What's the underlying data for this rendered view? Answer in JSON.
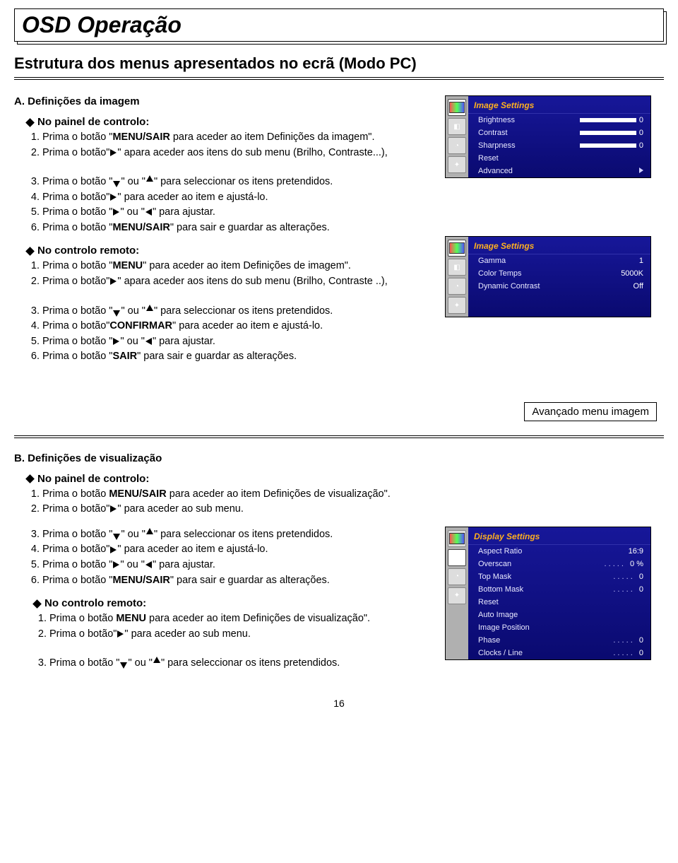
{
  "page": {
    "title": "OSD Operação",
    "subtitle": "Estrutura dos menus apresentados no ecrã (Modo PC)",
    "pageNumber": "16"
  },
  "sectionA": {
    "heading": "A. Definições da imagem",
    "panelHeading": "No painel de controlo:",
    "panelSteps": {
      "s1a": "Prima o botão \"",
      "s1b": "MENU/SAIR",
      "s1c": " para aceder ao item Definições da imagem\".",
      "s2a": "Prima o botão\"",
      "s2b": "\" apara aceder aos itens do sub menu (Brilho, Contraste...),",
      "s3a": "Prima o botão \"",
      "s3b": "\" ou \"",
      "s3c": "\" para seleccionar os itens pretendidos.",
      "s4a": "Prima o botão\"",
      "s4b": "\" para aceder ao item e ajustá-lo.",
      "s5a": "Prima o botão \"",
      "s5b": "\" ou \"",
      "s5c": "\" para ajustar.",
      "s6a": "Prima o botão \"",
      "s6b": "MENU/SAIR",
      "s6c": "\" para sair e guardar as alterações."
    },
    "remoteHeading": "No controlo remoto:",
    "remoteSteps": {
      "s1a": "Prima o botão \"",
      "s1b": "MENU",
      "s1c": "\" para aceder ao item Definições de imagem\".",
      "s2a": "Prima o botão\"",
      "s2b": "\" apara aceder aos itens do sub menu (Brilho, Contraste ..),",
      "s3a": "Prima o botão \"",
      "s3b": "\" ou \"",
      "s3c": "\" para seleccionar os itens pretendidos.",
      "s4a": "Prima o botão\"",
      "s4b": "CONFIRMAR",
      "s4c": "\" para aceder ao item e ajustá-lo.",
      "s5a": "Prima o botão \"",
      "s5b": "\" ou \"",
      "s5c": "\" para ajustar.",
      "s6a": "Prima o botão \"",
      "s6b": "SAIR",
      "s6c": "\" para sair e guardar as alterações."
    }
  },
  "osd1": {
    "header": "Image Settings",
    "rows": [
      {
        "label": "Brightness",
        "val": "0",
        "slider": true
      },
      {
        "label": "Contrast",
        "val": "0",
        "slider": true
      },
      {
        "label": "Sharpness",
        "val": "0",
        "slider": true
      },
      {
        "label": "Reset",
        "val": ""
      },
      {
        "label": "Advanced",
        "val": "▶"
      }
    ]
  },
  "osd2": {
    "header": "Image Settings",
    "rows": [
      {
        "label": "Gamma",
        "val": "1"
      },
      {
        "label": "Color Temps",
        "val": "5000K"
      },
      {
        "label": "Dynamic Contrast",
        "val": "Off"
      }
    ]
  },
  "callout": "Avançado menu imagem",
  "sectionB": {
    "heading": "B. Definições de visualização",
    "panelHeading": "No painel de controlo:",
    "panelSteps": {
      "s1a": "Prima o botão ",
      "s1b": "MENU/SAIR",
      "s1c": " para aceder ao item Definições de visualização\".",
      "s2a": "Prima o botão\"",
      "s2b": "\" para aceder ao sub menu.",
      "s3a": "Prima o botão \"",
      "s3b": "\" ou \"",
      "s3c": "\" para seleccionar os itens pretendidos.",
      "s4a": "Prima o botão\"",
      "s4b": "\" para aceder ao item e ajustá-lo.",
      "s5a": "Prima o botão \"",
      "s5b": "\" ou \"",
      "s5c": "\" para ajustar.",
      "s6a": "Prima o botão \"",
      "s6b": "MENU/SAIR",
      "s6c": "\" para sair e guardar as alterações."
    },
    "remoteHeading": "No controlo remoto:",
    "remoteSteps": {
      "s1a": "Prima o botão ",
      "s1b": "MENU",
      "s1c": " para aceder ao item Definições de visualização\".",
      "s2a": "Prima o botão\"",
      "s2b": "\" para aceder ao sub menu.",
      "s3a": "Prima o botão \"",
      "s3b": "\" ou \"",
      "s3c": "\" para seleccionar os itens pretendidos."
    }
  },
  "osd3": {
    "header": "Display Settings",
    "rows": [
      {
        "label": "Aspect Ratio",
        "val": "16:9"
      },
      {
        "label": "Overscan",
        "val": "0 %",
        "dots": true
      },
      {
        "label": "Top Mask",
        "val": "0",
        "dots": true
      },
      {
        "label": "Bottom Mask",
        "val": "0",
        "dots": true
      },
      {
        "label": "Reset",
        "val": ""
      },
      {
        "label": "Auto Image",
        "val": ""
      },
      {
        "label": "Image Position",
        "val": ""
      },
      {
        "label": "Phase",
        "val": "0",
        "dots": true
      },
      {
        "label": "Clocks / Line",
        "val": "0",
        "dots": true
      }
    ]
  }
}
